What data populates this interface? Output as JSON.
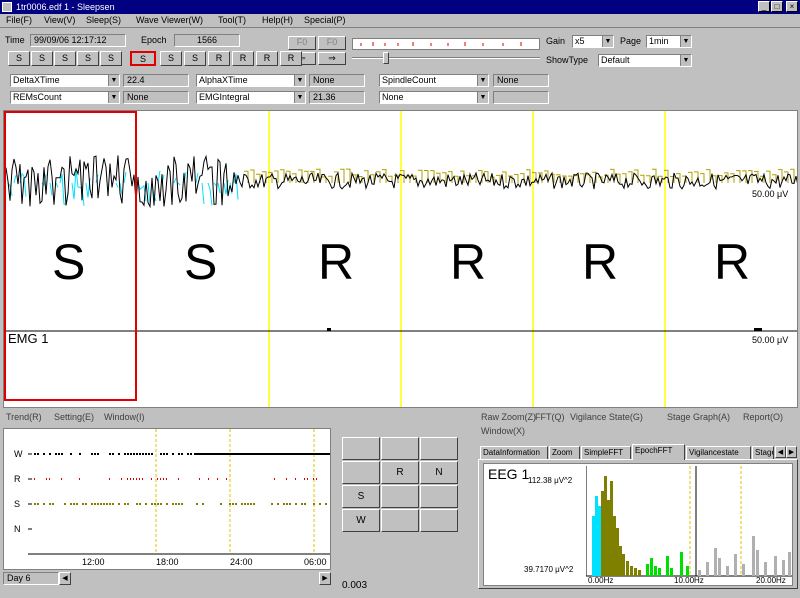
{
  "window": {
    "title": "1tr0006.edf 1 - Sleepsen",
    "min": "_",
    "max": "□",
    "close": "×"
  },
  "menu": [
    "File(F)",
    "View(V)",
    "Sleep(S)",
    "Wave Viewer(W)",
    "Tool(T)",
    "Help(H)",
    "Special(P)"
  ],
  "toolbar": {
    "time_label": "Time",
    "time_value": "99/09/06 12:17:12",
    "epoch_label": "Epoch",
    "epoch_value": "1566",
    "stage_buttons": [
      "S",
      "S",
      "S",
      "S",
      "S",
      "S",
      "S",
      "S",
      "R",
      "R",
      "R",
      "R",
      "R"
    ],
    "selected_stage_index": 5,
    "btn_f0_1": "F0",
    "btn_f0_2": "F0",
    "btn_left": "⇐",
    "btn_right": "⇒",
    "gain_label": "Gain",
    "gain_value": "x5",
    "page_label": "Page",
    "page_value": "1min",
    "showtype_label": "ShowType",
    "showtype_value": "Default"
  },
  "params": {
    "row1": [
      {
        "select": "DeltaXTime",
        "value": "22.4"
      },
      {
        "select": "AlphaXTime",
        "value": "None"
      },
      {
        "select": "SpindleCount",
        "value": "None"
      }
    ],
    "row2": [
      {
        "select": "REMsCount",
        "value": "None"
      },
      {
        "select": "EMGIntegral",
        "value": "21.36"
      },
      {
        "select": "None",
        "value": ""
      }
    ]
  },
  "wave": {
    "stages": [
      "S",
      "S",
      "R",
      "R",
      "R",
      "R"
    ],
    "eeg_scale": "50.00 μV",
    "emg_label": "EMG 1",
    "emg_scale": "50.00 μV"
  },
  "trend": {
    "menu": [
      "Trend(R)",
      "Setting(E)",
      "Window(I)"
    ],
    "y_labels": [
      "W",
      "R",
      "S",
      "N"
    ],
    "x_labels": [
      "12:00",
      "18:00",
      "24:00",
      "06:00"
    ],
    "day_label": "Day 6",
    "grid": [
      "",
      "",
      "",
      "",
      "R",
      "N",
      "S",
      "",
      "",
      "W",
      "",
      ""
    ],
    "value": "0.003"
  },
  "fft": {
    "menu": [
      "Raw Zoom(Z)",
      "FFT(Q)",
      "Vigilance State(G)",
      "Stage Graph(A)",
      "Report(O)",
      "Window(X)"
    ],
    "tabs": [
      "DataInformation",
      "Zoom",
      "SimpleFFT",
      "EpochFFT",
      "Vigilancestate",
      "Stage"
    ],
    "active_tab_index": 3,
    "channel": "EEG 1",
    "y_top": "112.38 μV^2",
    "y_bottom": "39.7170 μV^2",
    "x_labels": [
      "0.00Hz",
      "10.00Hz",
      "20.00Hz"
    ]
  },
  "colors": {
    "titlebar": "#000080",
    "eeg": "#000000",
    "cyan": "#00e0ff",
    "olive": "#808000",
    "yellow": "#ffff00",
    "red_border": "#e00000",
    "green": "#00e000",
    "gray": "#b0b0b0"
  }
}
